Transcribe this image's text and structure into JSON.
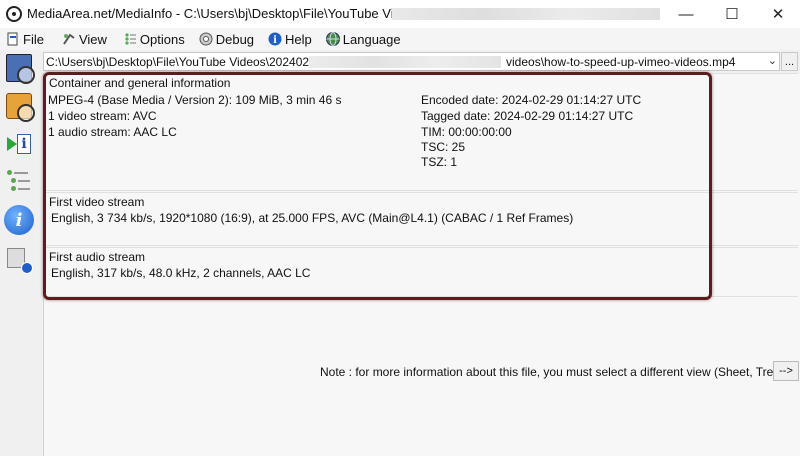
{
  "window": {
    "title": "MediaArea.net/MediaInfo - C:\\Users\\bj\\Desktop\\File\\YouTube Videos\\2024",
    "minimize_glyph": "—",
    "maximize_glyph": "☐",
    "close_glyph": "✕"
  },
  "menu": [
    {
      "label": "File",
      "icon": "file-icon"
    },
    {
      "label": "View",
      "icon": "view-icon"
    },
    {
      "label": "Options",
      "icon": "options-icon"
    },
    {
      "label": "Debug",
      "icon": "debug-icon"
    },
    {
      "label": "Help",
      "icon": "help-icon"
    },
    {
      "label": "Language",
      "icon": "language-icon"
    }
  ],
  "path": {
    "prefix": "C:\\Users\\bj\\Desktop\\File\\YouTube Videos\\20240226",
    "suffix": "videos\\how-to-speed-up-vimeo-videos.mp4",
    "dropdown_glyph": "⌄",
    "button_label": "..."
  },
  "general": {
    "title": "Container and general information",
    "left": [
      "MPEG-4 (Base Media / Version 2): 109 MiB, 3 min 46 s",
      "1 video stream: AVC",
      "1 audio stream: AAC LC"
    ],
    "right": [
      "Encoded date: 2024-02-29 01:14:27 UTC",
      "Tagged date: 2024-02-29 01:14:27 UTC",
      "TIM: 00:00:00:00",
      "TSC: 25",
      "TSZ: 1"
    ]
  },
  "video": {
    "title": "First video stream",
    "line": "English, 3 734 kb/s, 1920*1080 (16:9), at 25.000 FPS, AVC (Main@L4.1) (CABAC / 1 Ref Frames)"
  },
  "audio": {
    "title": "First audio stream",
    "line": "English, 317 kb/s, 48.0 kHz, 2 channels, AAC LC"
  },
  "note": {
    "text": "Note : for more information about this file, you must select a different view (Sheet, Tree...)",
    "button_label": "-->"
  },
  "toolbar": [
    {
      "name": "sheet-view-icon"
    },
    {
      "name": "basic-view-icon"
    },
    {
      "name": "export-info-icon"
    },
    {
      "name": "tree-view-icon"
    },
    {
      "name": "about-info-icon"
    },
    {
      "name": "options-settings-icon"
    }
  ]
}
